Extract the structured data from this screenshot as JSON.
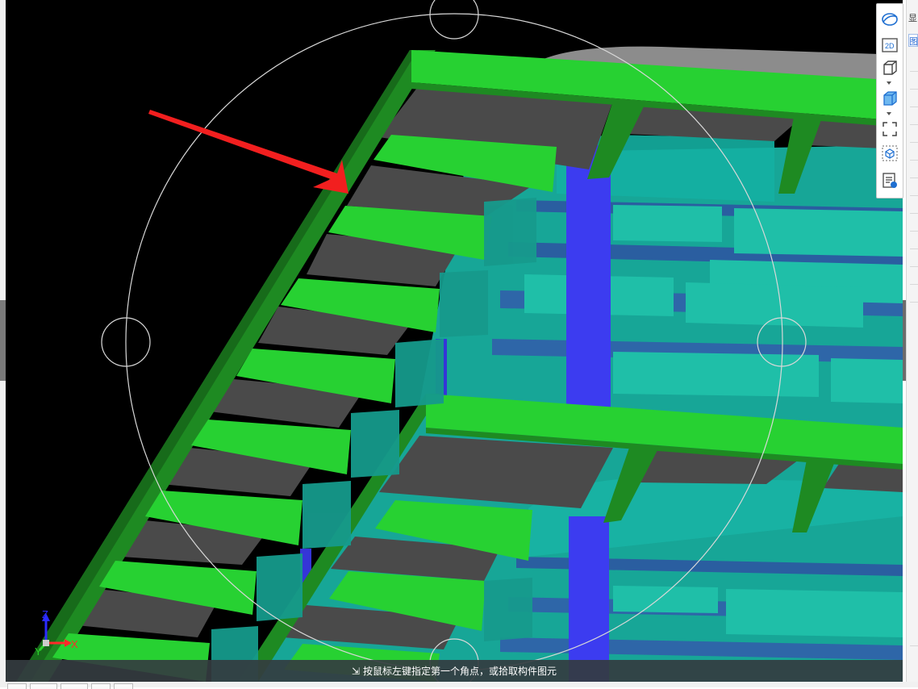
{
  "status_bar": {
    "message": "按鼠标左键指定第一个角点，或拾取构件图元"
  },
  "axes": {
    "x_label": "X",
    "y_label": "Y",
    "z_label": "Z"
  },
  "toolbar": {
    "buttons": [
      {
        "name": "orbit-icon"
      },
      {
        "name": "2d-view-icon",
        "label": "2D"
      },
      {
        "name": "3d-box-icon"
      },
      {
        "name": "3d-solid-box-icon"
      },
      {
        "name": "zoom-extents-icon"
      },
      {
        "name": "section-box-icon"
      },
      {
        "name": "properties-view-icon"
      }
    ]
  },
  "right_panel": {
    "tab_label": "显",
    "tab2_label": "图"
  },
  "colors": {
    "viewport_bg": "#000000",
    "beam_green": "#27d132",
    "beam_side_dark": "#1e8a22",
    "slab_dark": "#4a4a4a",
    "wall_teal": "#16a89a",
    "column_blue": "#3a3ae8",
    "annotation_arrow": "#f21f1f"
  }
}
